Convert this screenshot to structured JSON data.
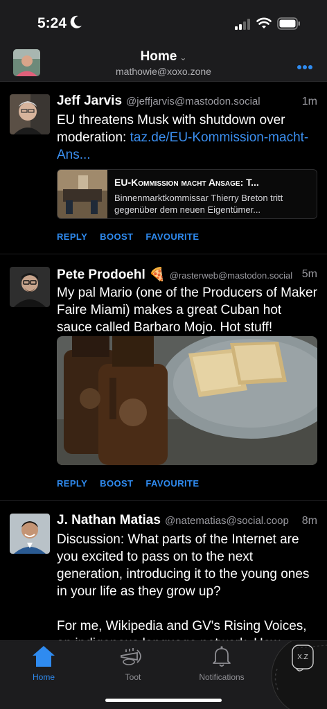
{
  "status_bar": {
    "time": "5:24"
  },
  "header": {
    "title": "Home",
    "account": "mathowie@xoxo.zone",
    "more_icon": "ellipsis-icon"
  },
  "posts": [
    {
      "author": "Jeff Jarvis",
      "handle": "@jeffjarvis@mastodon.social",
      "time": "1m",
      "text": "EU threatens Musk with shutdown over moderation: ",
      "link_text": "taz.de/EU-Kommission-macht-Ans...",
      "card": {
        "title": "EU-Kommission macht Ansage: T...",
        "description": "Binnenmarktkommissar Thierry Breton tritt gegenüber dem neuen Eigentümer..."
      },
      "actions": {
        "reply": "REPLY",
        "boost": "BOOST",
        "favourite": "FAVOURITE"
      }
    },
    {
      "author": "Pete Prodoehl 🍕",
      "handle": "@rasterweb@mastodon.social",
      "time": "5m",
      "text": "My pal Mario (one of the Producers of Maker Faire Miami) makes a great Cuban hot sauce called Barbaro Mojo. Hot stuff!",
      "actions": {
        "reply": "REPLY",
        "boost": "BOOST",
        "favourite": "FAVOURITE"
      }
    },
    {
      "author": "J. Nathan Matias",
      "handle": "@natematias@social.coop",
      "time": "8m",
      "text_p1": "Discussion: What parts of the Internet are you excited to pass on to the next generation, introducing it to the young ones in your life as they grow up?",
      "text_p2": "For me, Wikipedia and GV's Rising Voices, an indigenous language network. How"
    }
  ],
  "tabs": [
    {
      "label": "Home",
      "icon": "house-icon",
      "active": true
    },
    {
      "label": "Toot",
      "icon": "trumpet-icon",
      "active": false
    },
    {
      "label": "Notifications",
      "icon": "bell-icon",
      "active": false
    }
  ],
  "badge_text": "X.Z",
  "colors": {
    "accent": "#2f8bf0",
    "background": "#000000",
    "bar": "#1c1c1e"
  }
}
